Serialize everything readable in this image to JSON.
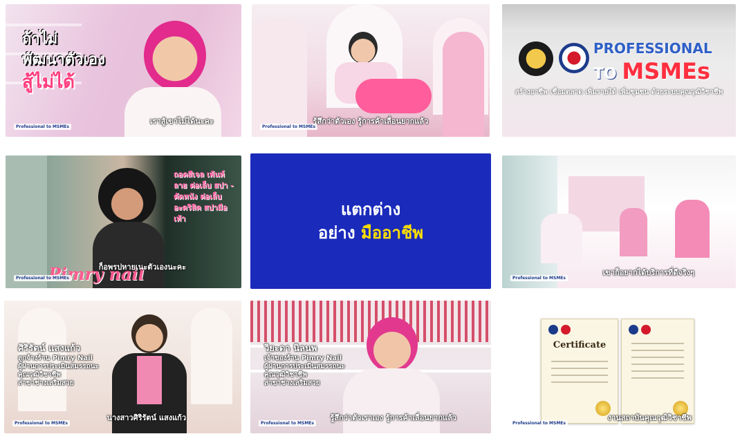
{
  "tiles": [
    {
      "overlay_lines": [
        "ถ้าไม่",
        "พัฒนาตัวเอง",
        "สู้ไม่ได้"
      ],
      "subtitle": "เราสู้เขาไม่ได้นะคะ",
      "badge": "Professional to MSMEs"
    },
    {
      "subtitle": "รู้สึกว่าตัวเอง รู้การค้าเลื่อนยากแล้ว",
      "badge": "Professional to MSMEs"
    },
    {
      "title_line1": "PROFESSIONAL",
      "title_to": "TO",
      "title_msmes": "MSMEs",
      "tagline": "สร้างอาชีพ เชื่อมตลาด เพิ่มรายได้ เพิ่มชุมชน ด้วยระบบคุณวุฒิวิชาชีพ"
    },
    {
      "side_text": "ถอดสีเจล เพ้นท์ลาย ต่อเล็บ สปา - ตัดหนัง ต่อเล็บ อะคริลิค สปามือเท้า",
      "brand": "Pimry nail",
      "subtitle": "ก็อพรปหายเนะตัวเองนะคะ",
      "badge": "Professional to MSMEs"
    },
    {
      "line1": "แตกต่าง",
      "line2_prefix": "อย่าง",
      "line2_highlight": "มืออาชีพ"
    },
    {
      "subtitle": "เขาก็อยากได้บริการที่ดีจริงๆ",
      "badge": "Professional to MSMEs"
    },
    {
      "name_lines": [
        "ศิริรัตน์ แสงแก้ว",
        "ลูกจ้างร้าน Pimry Nail",
        "ผู้ผ่านการประเมินสมรรถนะ",
        "คุณวุฒิวิชาชีพ",
        "สาขาช่างเสริมสวย"
      ],
      "subtitle": "นางสาวศิริรัตน์ แสงแก้ว",
      "badge": "Professional to MSMEs"
    },
    {
      "name_lines": [
        "วิยะดา นิลนพ",
        "เจ้าของร้าน Pimry Nail",
        "ผู้ผ่านการประเมินสมรรถนะ",
        "คุณวุฒิวิชาชีพ",
        "สาขาช่างเสริมสวย"
      ],
      "subtitle": "รู้สึกว่าตัวเราเอง รู้การค้าเลื่อนยากแล้ว",
      "badge": "Professional to MSMEs"
    },
    {
      "cert_title": "Certificate",
      "subtitle": "งานสถาบันคุณวุฒิวิชาชีพ",
      "badge": "Professional to MSMEs"
    }
  ],
  "colors": {
    "brand_blue": "#1a2bbb",
    "accent_pink": "#ff3c7d",
    "accent_yellow": "#ffe000",
    "msmes_red": "#ff2f3f"
  }
}
